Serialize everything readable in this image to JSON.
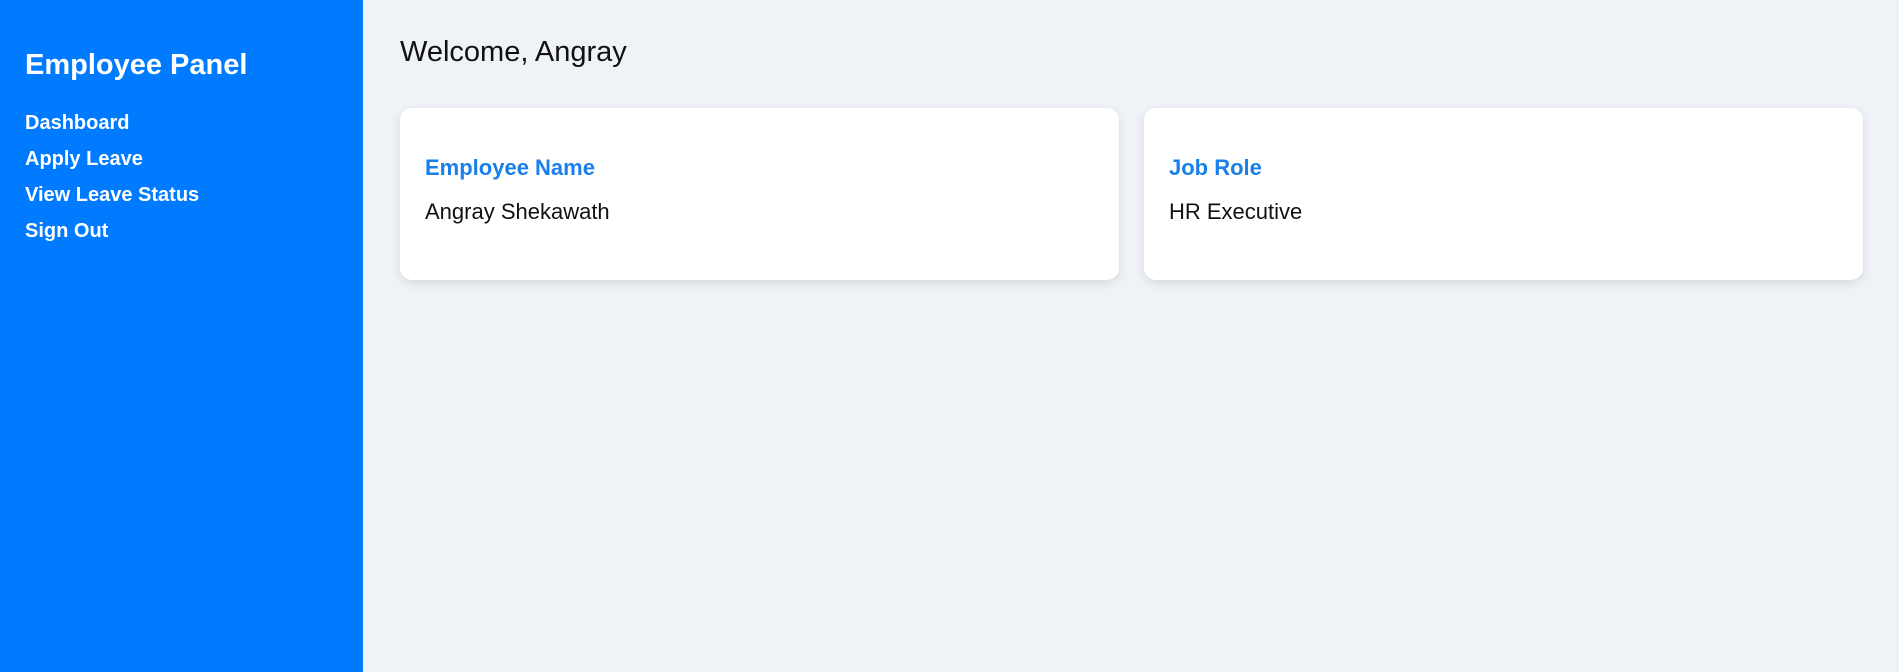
{
  "sidebar": {
    "title": "Employee Panel",
    "items": [
      {
        "label": "Dashboard"
      },
      {
        "label": "Apply Leave"
      },
      {
        "label": "View Leave Status"
      },
      {
        "label": "Sign Out"
      }
    ]
  },
  "main": {
    "welcome": "Welcome, Angray",
    "cards": [
      {
        "label": "Employee Name",
        "value": "Angray Shekawath"
      },
      {
        "label": "Job Role",
        "value": "HR Executive"
      }
    ]
  },
  "colors": {
    "sidebar_bg": "#007bff",
    "page_bg": "#eff2f7",
    "accent": "#1a7fe8"
  }
}
